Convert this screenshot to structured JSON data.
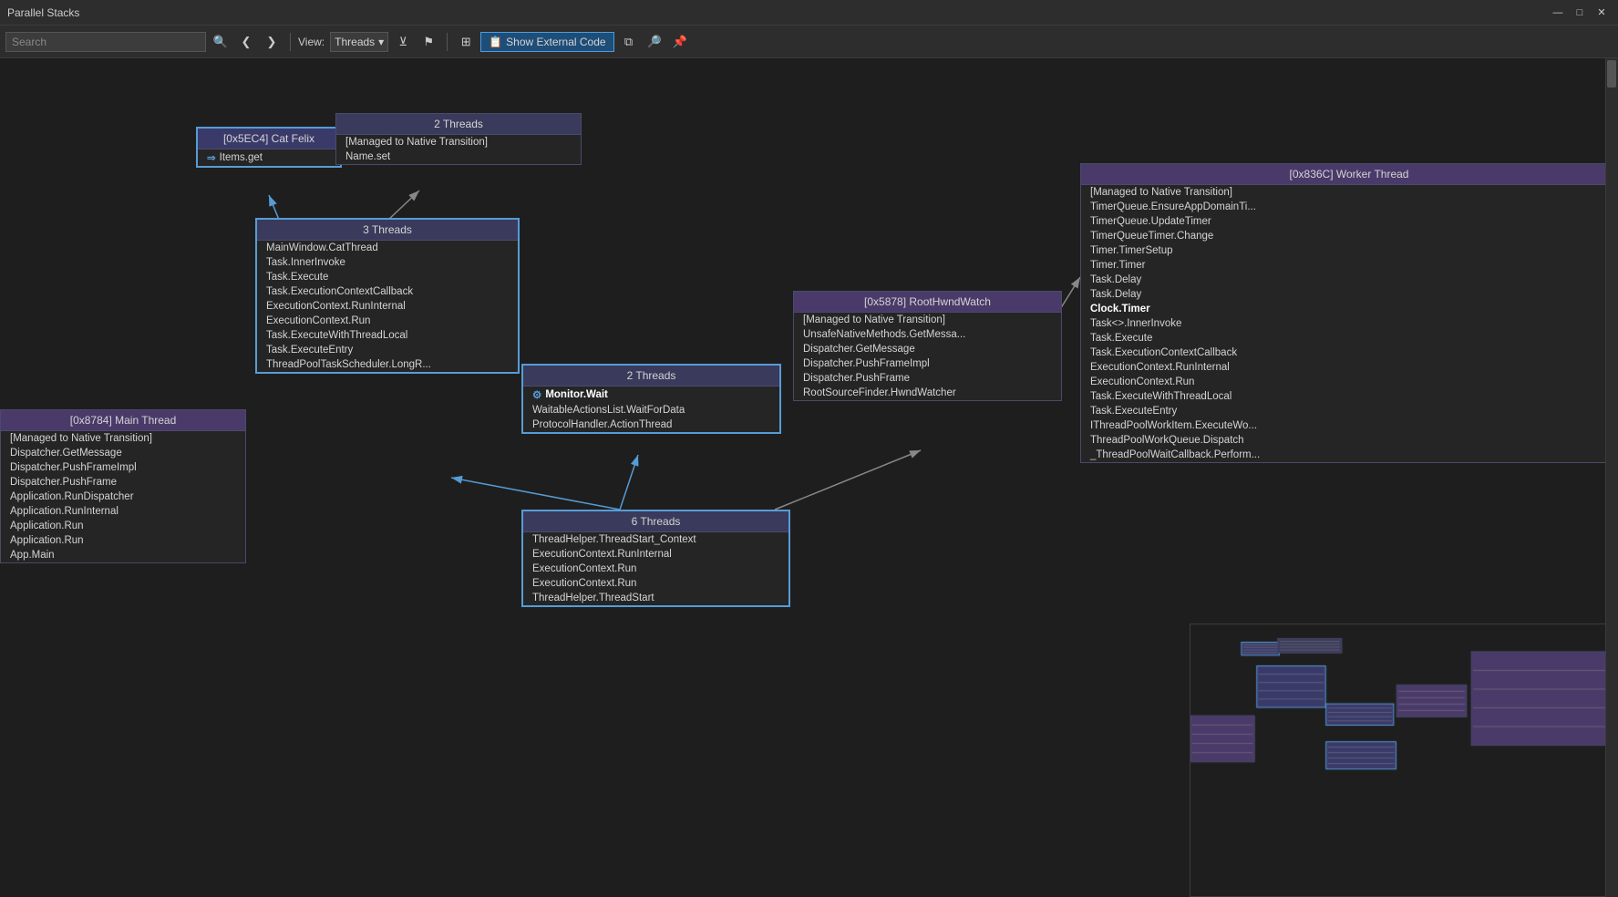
{
  "titleBar": {
    "title": "Parallel Stacks",
    "controls": [
      "minimize",
      "maximize",
      "close"
    ]
  },
  "toolbar": {
    "searchPlaceholder": "Search",
    "viewLabel": "View:",
    "viewValue": "Threads",
    "showExternalLabel": "Show External Code",
    "buttons": [
      "back",
      "forward",
      "search-icon",
      "filter-icon",
      "flag-icon",
      "layout-icon",
      "zoom-icon",
      "pin-icon"
    ]
  },
  "nodes": {
    "catFelix": {
      "header": "[0x5EC4] Cat Felix",
      "items": [
        "Items.get"
      ],
      "activeItem": "Items.get"
    },
    "twoThreadsTop": {
      "header": "2 Threads",
      "items": [
        "[Managed to Native Transition]",
        "Name.set"
      ]
    },
    "threeThreads": {
      "header": "3 Threads",
      "items": [
        "MainWindow.CatThread",
        "Task.InnerInvoke",
        "Task.Execute",
        "Task.ExecutionContextCallback",
        "ExecutionContext.RunInternal",
        "ExecutionContext.Run",
        "Task.ExecuteWithThreadLocal",
        "Task.ExecuteEntry",
        "ThreadPoolTaskScheduler.LongR..."
      ]
    },
    "mainThread": {
      "header": "[0x8784] Main Thread",
      "items": [
        "[Managed to Native Transition]",
        "Dispatcher.GetMessage",
        "Dispatcher.PushFrameImpl",
        "Dispatcher.PushFrame",
        "Application.RunDispatcher",
        "Application.RunInternal",
        "Application.Run",
        "Application.Run",
        "App.Main"
      ]
    },
    "twoThreadsMonitor": {
      "header": "2 Threads",
      "activeItem": "Monitor.Wait",
      "items": [
        "Monitor.Wait",
        "WaitableActionsList.WaitForData",
        "ProtocolHandler.ActionThread"
      ]
    },
    "rootHwnd": {
      "header": "[0x5878] RootHwndWatch",
      "items": [
        "[Managed to Native Transition]",
        "UnsafeNativeMethods.GetMessa...",
        "Dispatcher.GetMessage",
        "Dispatcher.PushFrameImpl",
        "Dispatcher.PushFrame",
        "RootSourceFinder.HwndWatcher"
      ]
    },
    "sixThreads": {
      "header": "6 Threads",
      "items": [
        "ThreadHelper.ThreadStart_Context",
        "ExecutionContext.RunInternal",
        "ExecutionContext.Run",
        "ExecutionContext.Run",
        "ThreadHelper.ThreadStart"
      ]
    },
    "workerThread": {
      "header": "[0x836C] Worker Thread",
      "boldItem": "Clock.Timer",
      "items": [
        "[Managed to Native Transition]",
        "TimerQueue.EnsureAppDomainTi...",
        "TimerQueue.UpdateTimer",
        "TimerQueueTimer.Change",
        "Timer.TimerSetup",
        "Timer.Timer",
        "Task.Delay",
        "Task.Delay",
        "Clock.Timer",
        "Task<>.InnerInvoke",
        "Task.Execute",
        "Task.ExecutionContextCallback",
        "ExecutionContext.RunInternal",
        "ExecutionContext.Run",
        "Task.ExecuteWithThreadLocal",
        "Task.ExecuteEntry",
        "IThreadPoolWorkItem.ExecuteWo...",
        "ThreadPoolWorkQueue.Dispatch",
        "_ThreadPoolWaitCallback.Perform..."
      ]
    }
  }
}
